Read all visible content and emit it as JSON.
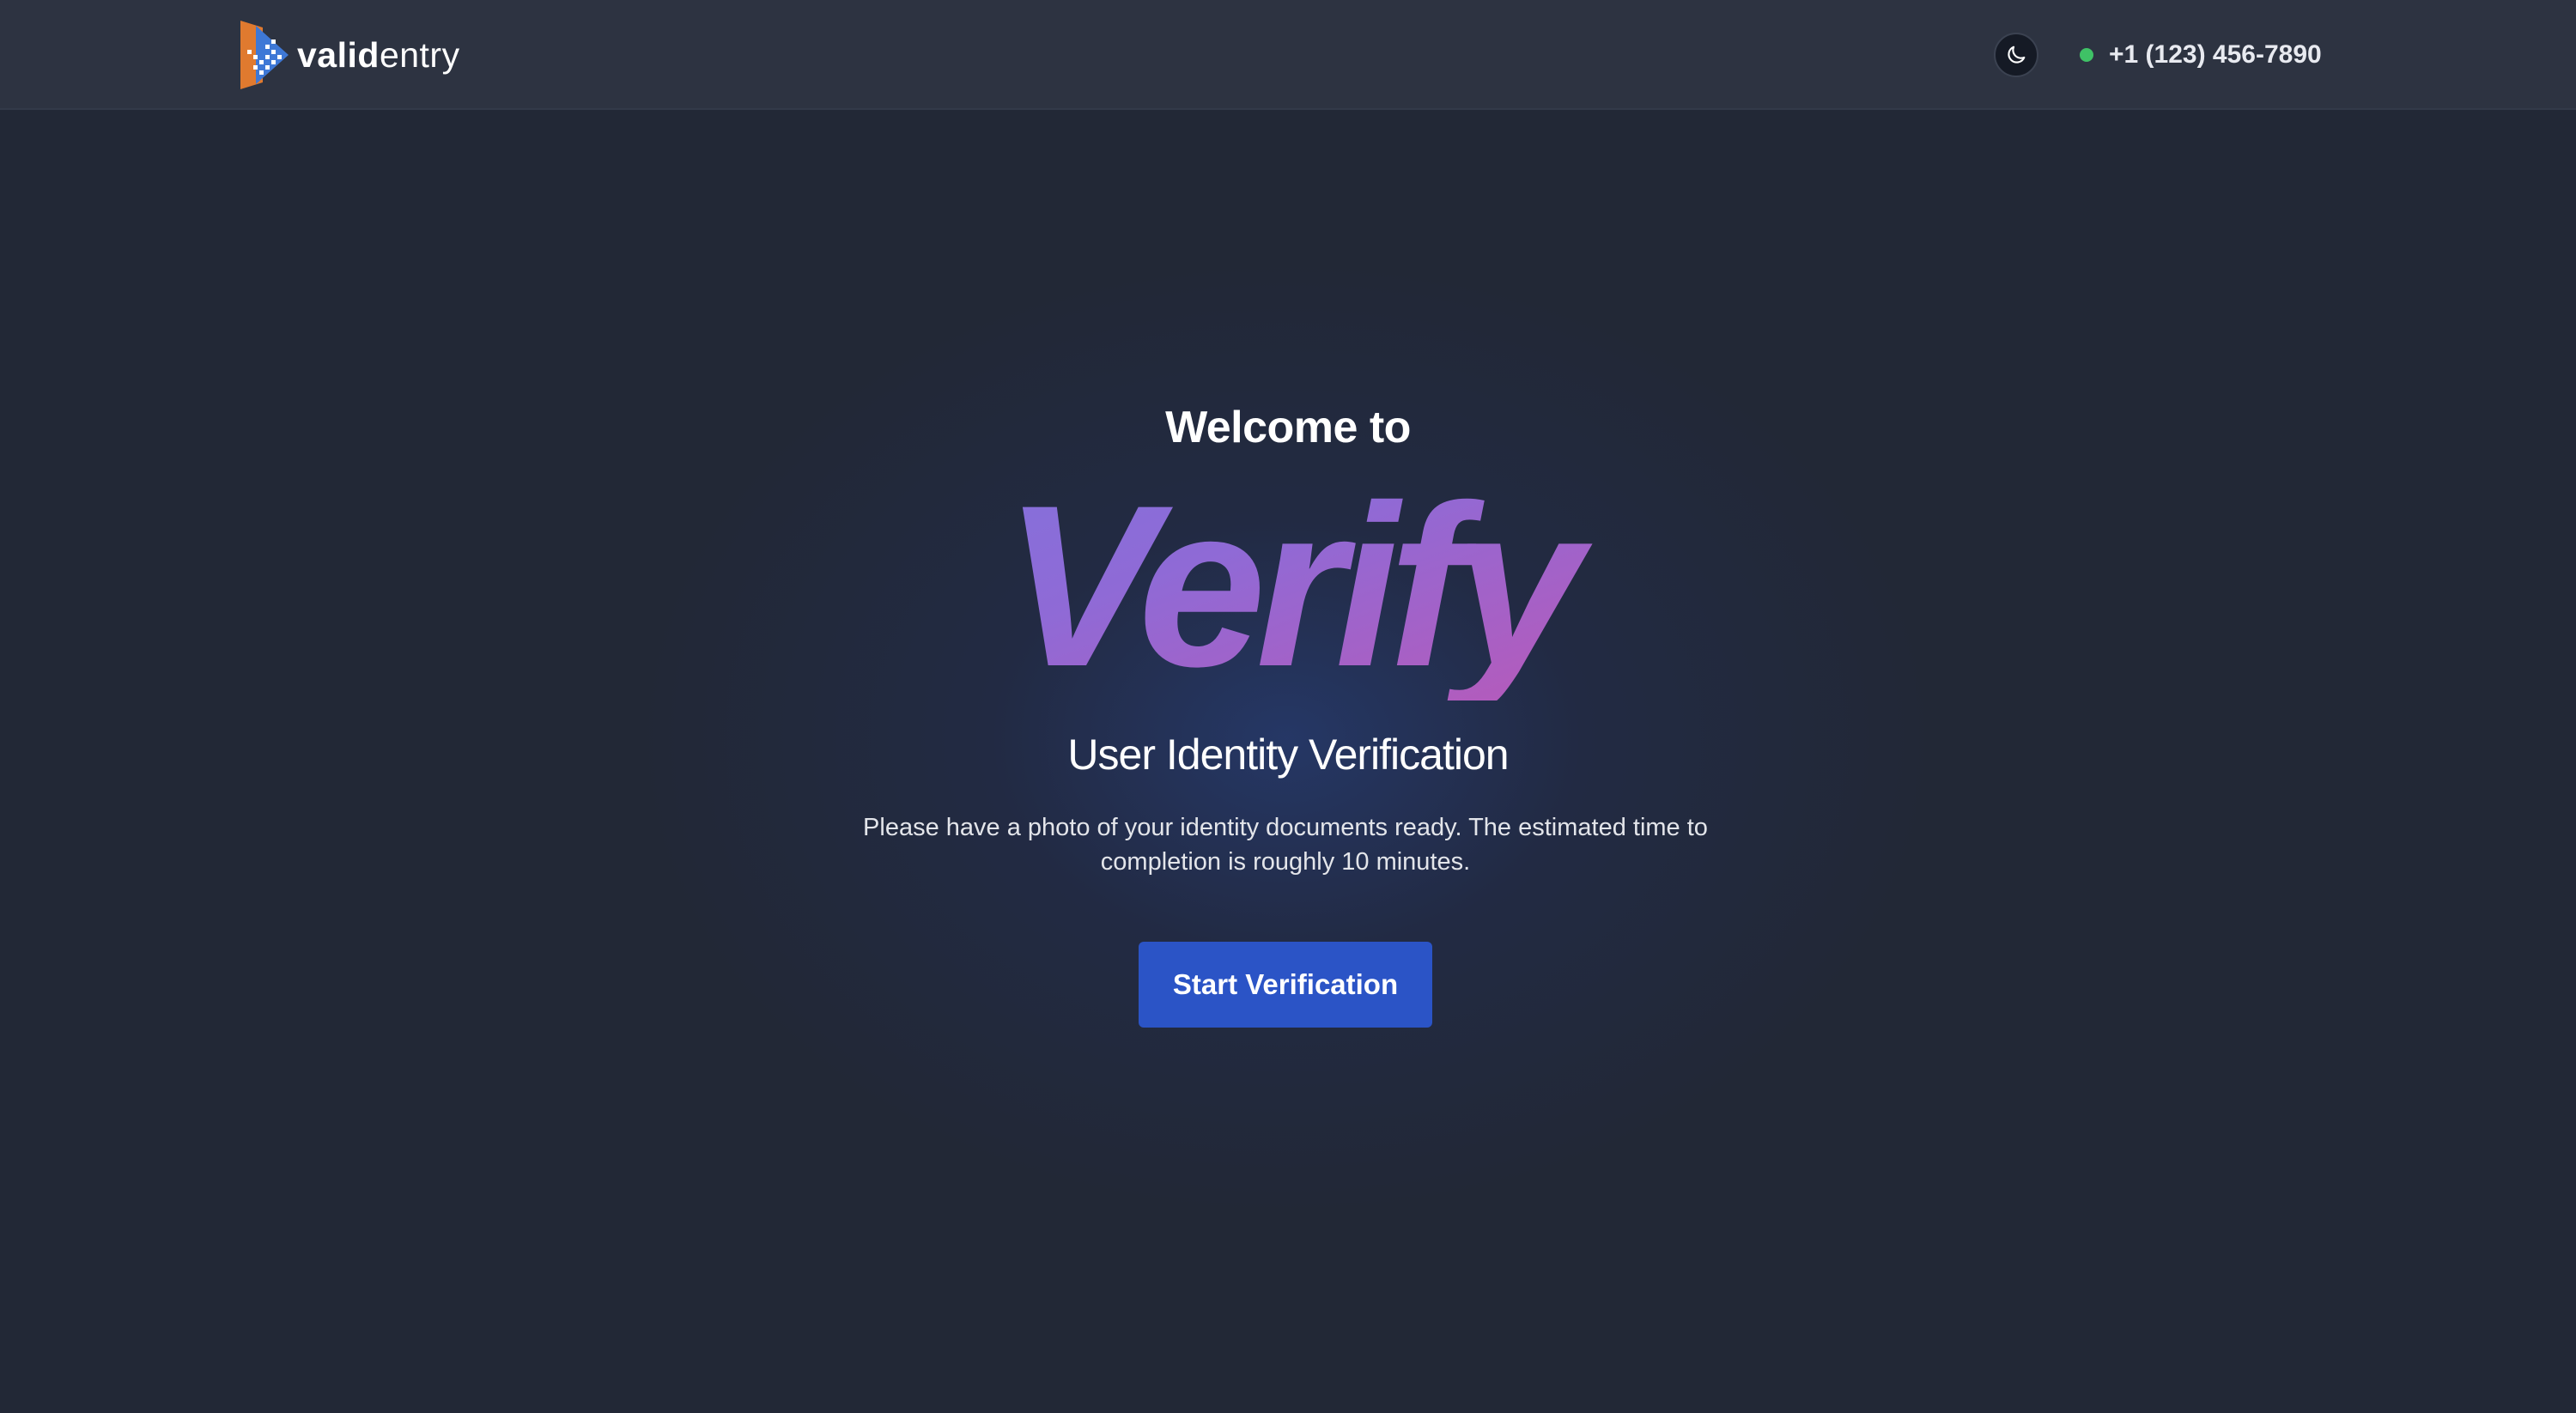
{
  "header": {
    "logo": {
      "text_bold": "valid",
      "text_light": "entry",
      "icon": "validentry-logo-icon",
      "colors": {
        "orange": "#e07a2f",
        "blue": "#3e78d6"
      }
    },
    "theme_toggle": {
      "icon": "moon-icon"
    },
    "status": {
      "indicator_color": "#3fc266",
      "phone": "+1 (123) 456-7890"
    }
  },
  "hero": {
    "welcome": "Welcome to",
    "brand": "Verify",
    "subtitle": "User Identity Verification",
    "description": "Please have a photo of your identity documents ready. The estimated time to completion is roughly 10 minutes.",
    "start_button": "Start Verification"
  },
  "colors": {
    "background": "#222836",
    "header": "#2d3341",
    "button": "#2b54c6",
    "gradient_start": "#6d7fe6",
    "gradient_end": "#e4489c"
  }
}
